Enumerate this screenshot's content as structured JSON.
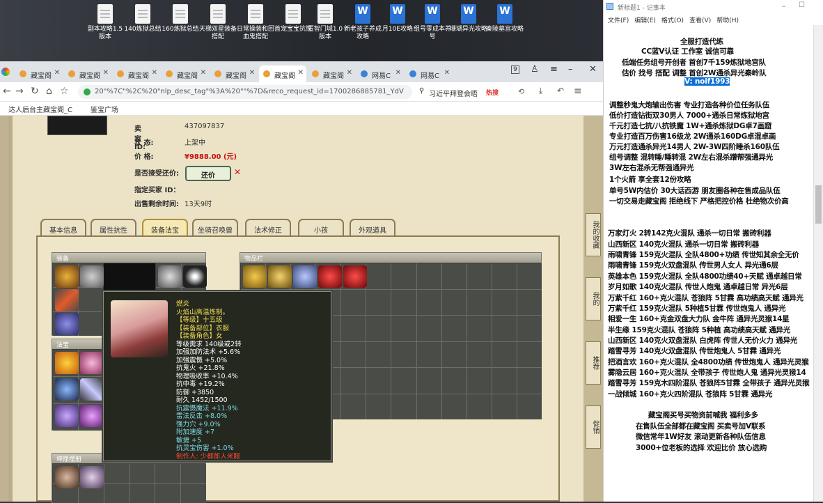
{
  "desktop": {
    "icons": [
      {
        "label": "副本攻略1.5版本",
        "type": "txt"
      },
      {
        "label": "140炼狱总结",
        "type": "txt"
      },
      {
        "label": "160炼狱总结",
        "type": "txt"
      },
      {
        "label": "天梯双星装备搭配",
        "type": "txt"
      },
      {
        "label": "日常操装和回血鬼搭配",
        "type": "txt"
      },
      {
        "label": "首宠宝宝抗性",
        "type": "txt"
      },
      {
        "label": "匿智门城1.0版本",
        "type": "txt"
      },
      {
        "label": "新老孩子养成攻略",
        "type": "doc"
      },
      {
        "label": "月10E攻略",
        "type": "doc"
      },
      {
        "label": "组号零成本养号",
        "type": "doc"
      },
      {
        "label": "珊瑚异光攻略",
        "type": "doc"
      },
      {
        "label": "秦陵墓宫攻略",
        "type": "doc"
      }
    ]
  },
  "browser": {
    "tabs": [
      "藏宝阁",
      "藏宝阁",
      "藏宝阁",
      "藏宝阁",
      "藏宝阁",
      "藏宝阁",
      "藏宝阁",
      "网易C",
      "网易C"
    ],
    "tab_count": "9",
    "url": "20\"%7C\"%2C%20\"nlp_desc_tag\"%3A%20\"\"%7D&reco_request_id=1700286885781_YdV",
    "search": "习近平拜登会晤",
    "hot": "热搜",
    "bookmarks": [
      "达人后台主",
      "藏宝阁_C",
      "鉴宝广场"
    ]
  },
  "game": {
    "seller_label": "卖 家  ID:",
    "seller_id": "437097837",
    "status_label": "状   态:",
    "status": "上架中",
    "price_label": "价   格:",
    "price": "¥9888.00 (元)",
    "bargain_label": "是否接受还价:",
    "bargain_btn": "还价",
    "buyer_label": "指定买家 ID：",
    "time_label": "出售剩余时间:",
    "time_left": "13天9时",
    "tabs": [
      "基本信息",
      "属性抗性",
      "装备法宝",
      "坐骑召唤兽",
      "法术修正",
      "小孩",
      "外观道具"
    ],
    "sections": {
      "equip": "装备",
      "treasure": "法宝",
      "items": "物品栏",
      "jewel": "坤鼎摆册"
    },
    "tooltip": {
      "name": "燃炎",
      "desc": "火焰山高温炼制。",
      "lines_yellow": [
        "【等级】十五级",
        "【装备部位】衣服",
        "【装备角色】女",
        "等级需求 140级或2转",
        "加强加防法术 +5.6%",
        "加强震慑 +5.0%",
        "抗鬼火 +21.8%",
        "物理吸收率 +10.4%",
        "抗中毒 +19.2%",
        "防御 +3850",
        "耐久 1452/1500"
      ],
      "lines_cyan": [
        "抗震慑魔法 +11.9%",
        "雷法反击 +8.0%",
        "强力穴 +9.0%",
        "附加速度 +7",
        "敏捷 +5",
        "抗灵宝伤害 +1.0%"
      ],
      "maker": "制作人: 少都郎人米服"
    },
    "right_buttons": [
      "我的收藏",
      "我的",
      "推荐",
      "促销"
    ]
  },
  "notepad": {
    "title": "新标题1 - 记事本",
    "menu": [
      "文件(F)",
      "编辑(E)",
      "格式(O)",
      "查看(V)",
      "帮助(H)"
    ],
    "lines": [
      "全服打造代练",
      "CC蓝V认证  工作室  诚信可靠",
      "低端任务组号开创者             首创7千159炼狱地宫队",
      "估价 找号 搭配 调整            首创2W通杀异光秦岭队",
      "V:  noif1993",
      "调整秒鬼大炮输出伤害           专业打造各种价位任务队伍",
      "低价打造钻街双30男人             7000+通杀日常炼狱地宫",
      "千元打造七抗/八抗铁魔          1W+通杀炼狱DG卓7画窟",
      "专业打造百万伤害16级龙          2W通杀160DG卓混卓画",
      "万元打造通杀异光14男人         2W-3W四阶睡杀160队伍",
      "组号调整 混转睡/睡转混          2W左右混杀蹭帮强通异光",
      "                                          3W左右混杀无帮强通异光",
      "1个火箭 享全套12份攻略",
      "单号5W内估价 30大话西游        朋友圈各种在售成品队伍",
      "一切交易走藏宝阁 拒绝线下     严格把控价格 杜绝物次价高",
      "万家灯火 2转142克火混队 通杀一切日常 搬砖利器",
      "山西新区 140克火混队 通杀一切日常 搬砖利器",
      "雨啸青锋 159克火混队 全队4800+功绩 传世知其余全无价",
      "雨啸青锋 159克火双盘混队 传世男人女人 异光通6层",
      "英雄本色 159克火混队 全队4800功绩40+天赋 通卓越日常",
      "岁月如歌 140克火混队 传世人炮鬼 通卓越日常 异光6层",
      "万紫千红 160+克火混队 苍狼阵 5甘霖 高功绩高天赋 通异光",
      "万紫千红 159克火混队 5种植5甘霖 传世炮鬼人 通异光",
      "相爱一生 160+克金双盘大力队 金牛阵 通异光灵猴14星",
      "半生缘    159克火混队 苍狼阵 5种植 高功绩高天赋 通异光",
      "山西新区 140克火双盘混队 白虎阵 传世人无价火力 通异光",
      "踏雪寻芳 140克火双盘混队 传世炮鬼人 5甘霖 通异光",
      "把酒言欢 160+克火混队 全4800功绩 传世炮鬼人 通异光灵猴",
      "雾隐云居 160+克火混队 全带孩子 传世炮人鬼 通异光灵猴14",
      "踏雪寻芳 159克木四阶混队 苍狼阵5甘霖 全带孩子 通异光灵猴",
      "一战倾城 160+克火四阶混队 苍狼阵 5甘霖 通异光",
      "藏宝阁买号买物资前喊我 福利多多",
      "在售队伍全部都在藏宝阁 买卖号加V联系",
      "微信常年1W好友 滚动更新各种队伍信息",
      "3000+位老板的选择 欢迎比价 放心选购"
    ]
  }
}
